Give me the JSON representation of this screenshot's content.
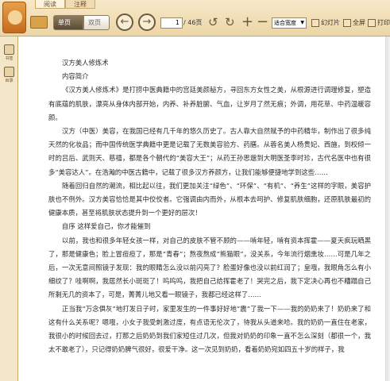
{
  "toolbar": {
    "tabs": [
      "阅读",
      "注释"
    ],
    "view_single": "单页",
    "view_double": "双页",
    "page_current": "1",
    "page_total": "/ 46页",
    "zoom": "适合宽度",
    "slideshow": "幻灯片",
    "fullscreen": "全屏",
    "print": "打印"
  },
  "sidebar": {
    "items": [
      "书签",
      "目录"
    ]
  },
  "content": {
    "title": "汉方美人修炼术",
    "subtitle": "内容简介",
    "paragraphs": [
      "《汉方美人修炼术》是打捞中医典籍中的宫廷美颜秘方，寻回东方女性之美，从根源进行调理修复，塑造有底蕴的肌肤，漂亮从身体内部开始，内养、补养脏腑、气血，让岁月了然无痕；外调，用花草、中药温暖容颜。",
      "汉方（中医）美容，在我国已经有几千年的悠久历史了。古人靠大自然赋予的中药精华，制作出了很多纯天然的化妆品；而中国传统医学典籍中更是记载了无数美容验方、药膳。从蓉名美人杨贵妃、西施，到权倾一时的吕后、武则天、慈禧，都是各个朝代的“美容大王”；从药王孙思邈到大明医圣李时珍，古代名医中也有很多“美容达人”。在浩瀚的中医古籍中，记载了很多汉方养颜方，让我们能够便捷地学到这些……",
      "随着回归自然的潮流，相比起以往，我们更加关注“绿色”、“环保”、“有机”、“养生”这样的字眼，美容护肤也不例外。汉方美容恰恰是其中佼佼者。它强调由内而外，从根本去呵护、修复肌肤细胞，还原肌肤最初的健康本质，甚至将肌肤状态提升到一个更好的层次！",
      "自序  这样爱自己，你才能催到",
      "以前，我也和很多年轻女孩一样，对自己的皮肤不管不顾的——啃年轻，啃有资本挥霍——夏天疯玩晒黑了，那是健康色；脸上冒痘痘了，那是“青春”；熬夜熬成“熊猫眼”，没关系，今年流行烟熏妆……可是几年之后，一次无意间照镜子发现：我的眼睛怎么没以前闪亮了？脸蛋好像也没以前红润了；皇哦，我眼角怎么有小细纹了？哇啊啊，我居然长小斑斑了！呜呜呜，我把自己给挥霍老了！哭完之后，我下定决心再也不糟蹋自己所剩无几的资本了，可是，菁菁儿地又看一眼镜子，我都已经这样了……",
      "正当我“万念俱灰”地打发日子时，家里发生的一件事好好地“震”了我一下——我的奶奶来了！奶奶来了和这有什么关系呢？嗯哦，小女子我受刺激过度，有点语无伦次了，待我从头道来哈。我的奶奶一直住在老家，我很小的时候回去过，打那之后奶奶到我们家短住过几次，但我对奶奶的印象一直不怎么深刻（都很一个，我太不敢老了），只记得奶奶脾气很好，很爱干净。这一次见到奶奶，看着奶奶宛如四五十岁的样子，我"
    ]
  }
}
